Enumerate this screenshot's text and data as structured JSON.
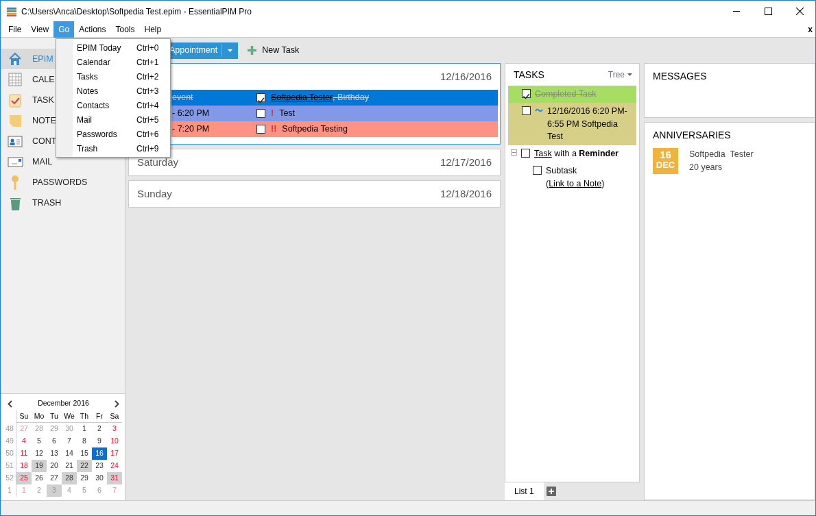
{
  "window": {
    "title": "C:\\Users\\Anca\\Desktop\\Softpedia Test.epim - EssentialPIM Pro"
  },
  "menu_bar": [
    {
      "label": "File",
      "selected": false
    },
    {
      "label": "View",
      "selected": false
    },
    {
      "label": "Go",
      "selected": true
    },
    {
      "label": "Actions",
      "selected": false
    },
    {
      "label": "Tools",
      "selected": false
    },
    {
      "label": "Help",
      "selected": false
    }
  ],
  "menu_close": "x",
  "go_menu": [
    {
      "label": "EPIM Today",
      "shortcut": "Ctrl+0"
    },
    {
      "label": "Calendar",
      "shortcut": "Ctrl+1"
    },
    {
      "label": "Tasks",
      "shortcut": "Ctrl+2"
    },
    {
      "label": "Notes",
      "shortcut": "Ctrl+3"
    },
    {
      "label": "Contacts",
      "shortcut": "Ctrl+4"
    },
    {
      "label": "Mail",
      "shortcut": "Ctrl+5"
    },
    {
      "label": "Passwords",
      "shortcut": "Ctrl+6"
    },
    {
      "label": "Trash",
      "shortcut": "Ctrl+9"
    }
  ],
  "toolbar": {
    "appointment_button": "Appointment",
    "new_task_button": "New Task"
  },
  "sidebar": {
    "items": [
      {
        "label": "EPIM",
        "kind": "home",
        "selected": true
      },
      {
        "label": "CALE",
        "kind": "calendar",
        "selected": false
      },
      {
        "label": "TASK",
        "kind": "tasks",
        "selected": false
      },
      {
        "label": "NOTE",
        "kind": "notes",
        "selected": false
      },
      {
        "label": "CONT",
        "kind": "contacts",
        "selected": false
      },
      {
        "label": "MAIL",
        "kind": "mail",
        "selected": false
      },
      {
        "label": "PASSWORDS",
        "kind": "passwords",
        "selected": false
      },
      {
        "label": "TRASH",
        "kind": "trash",
        "selected": false
      }
    ]
  },
  "mini_calendar": {
    "month": "December  2016",
    "weekdays": [
      "Su",
      "Mo",
      "Tu",
      "We",
      "Th",
      "Fr",
      "Sa"
    ],
    "weeks": [
      {
        "number": "48",
        "days": [
          {
            "text": "27",
            "other_month": true,
            "marked": false,
            "selected": false
          },
          {
            "text": "28",
            "other_month": true,
            "marked": false,
            "selected": false
          },
          {
            "text": "29",
            "other_month": true,
            "marked": false,
            "selected": false
          },
          {
            "text": "30",
            "other_month": true,
            "marked": false,
            "selected": false
          },
          {
            "text": "1",
            "other_month": false,
            "marked": false,
            "selected": false
          },
          {
            "text": "2",
            "other_month": false,
            "marked": false,
            "selected": false
          },
          {
            "text": "3",
            "other_month": false,
            "marked": false,
            "selected": false
          }
        ]
      },
      {
        "number": "49",
        "days": [
          {
            "text": "4",
            "other_month": false,
            "marked": false,
            "selected": false
          },
          {
            "text": "5",
            "other_month": false,
            "marked": false,
            "selected": false
          },
          {
            "text": "6",
            "other_month": false,
            "marked": false,
            "selected": false
          },
          {
            "text": "7",
            "other_month": false,
            "marked": false,
            "selected": false
          },
          {
            "text": "8",
            "other_month": false,
            "marked": false,
            "selected": false
          },
          {
            "text": "9",
            "other_month": false,
            "marked": false,
            "selected": false
          },
          {
            "text": "10",
            "other_month": false,
            "marked": false,
            "selected": false
          }
        ]
      },
      {
        "number": "50",
        "days": [
          {
            "text": "11",
            "other_month": false,
            "marked": false,
            "selected": false
          },
          {
            "text": "12",
            "other_month": false,
            "marked": false,
            "selected": false
          },
          {
            "text": "13",
            "other_month": false,
            "marked": false,
            "selected": false
          },
          {
            "text": "14",
            "other_month": false,
            "marked": false,
            "selected": false
          },
          {
            "text": "15",
            "other_month": false,
            "marked": false,
            "selected": false
          },
          {
            "text": "16",
            "other_month": false,
            "marked": false,
            "selected": true
          },
          {
            "text": "17",
            "other_month": false,
            "marked": false,
            "selected": false
          }
        ]
      },
      {
        "number": "51",
        "days": [
          {
            "text": "18",
            "other_month": false,
            "marked": false,
            "selected": false
          },
          {
            "text": "19",
            "other_month": false,
            "marked": true,
            "selected": false
          },
          {
            "text": "20",
            "other_month": false,
            "marked": false,
            "selected": false
          },
          {
            "text": "21",
            "other_month": false,
            "marked": false,
            "selected": false
          },
          {
            "text": "22",
            "other_month": false,
            "marked": true,
            "selected": false
          },
          {
            "text": "23",
            "other_month": false,
            "marked": false,
            "selected": false
          },
          {
            "text": "24",
            "other_month": false,
            "marked": false,
            "selected": false
          }
        ]
      },
      {
        "number": "52",
        "days": [
          {
            "text": "25",
            "other_month": false,
            "marked": true,
            "selected": false
          },
          {
            "text": "26",
            "other_month": false,
            "marked": false,
            "selected": false
          },
          {
            "text": "27",
            "other_month": false,
            "marked": false,
            "selected": false
          },
          {
            "text": "28",
            "other_month": false,
            "marked": true,
            "selected": false
          },
          {
            "text": "29",
            "other_month": false,
            "marked": false,
            "selected": false
          },
          {
            "text": "30",
            "other_month": false,
            "marked": false,
            "selected": false
          },
          {
            "text": "31",
            "other_month": false,
            "marked": true,
            "selected": false
          }
        ]
      },
      {
        "number": "1",
        "days": [
          {
            "text": "1",
            "other_month": true,
            "marked": false,
            "selected": false
          },
          {
            "text": "2",
            "other_month": true,
            "marked": false,
            "selected": false
          },
          {
            "text": "3",
            "other_month": true,
            "marked": true,
            "selected": false
          },
          {
            "text": "4",
            "other_month": true,
            "marked": false,
            "selected": false
          },
          {
            "text": "5",
            "other_month": true,
            "marked": false,
            "selected": false
          },
          {
            "text": "6",
            "other_month": true,
            "marked": false,
            "selected": false
          },
          {
            "text": "7",
            "other_month": true,
            "marked": false,
            "selected": false
          }
        ]
      }
    ]
  },
  "days": [
    {
      "date": "12/16/2016",
      "selected": true,
      "events": [
        {
          "lead": "event",
          "checked": true,
          "link": "Softpedia  Tester",
          "title": ", Birthday",
          "color": "#0078d7"
        },
        {
          "lead": "- 6:20 PM",
          "checked": false,
          "priority": "!",
          "title": "Test",
          "color": "#8199e6"
        },
        {
          "lead": "- 7:20 PM",
          "checked": false,
          "priority": "!!",
          "title": "Softpedia Testing",
          "color": "#ff9282"
        }
      ]
    },
    {
      "name": "Saturday",
      "date": "12/17/2016",
      "selected": false
    },
    {
      "name": "Sunday",
      "date": "12/18/2016",
      "selected": false
    }
  ],
  "tasks": {
    "title": "TASKS",
    "view": "Tree",
    "items": [
      {
        "checked": true,
        "parts": [
          {
            "text": "Completed Task"
          }
        ],
        "color": "#a8dd64"
      },
      {
        "checked": false,
        "recurring": true,
        "parts": [
          {
            "text": "12/16/2016 6:20 PM-6:55 PM Softpedia Test"
          }
        ],
        "color": "#d6cf88"
      },
      {
        "checked": false,
        "expanded": true,
        "parts": [
          {
            "text": "Task",
            "link": true
          },
          {
            "text": " with a **Reminder**"
          }
        ],
        "children": [
          {
            "checked": false,
            "parts": [
              {
                "text": "Subtask ("
              },
              {
                "text": "Link to a Note",
                "link": true
              },
              {
                "text": ")"
              }
            ]
          }
        ]
      }
    ],
    "tabs": [
      {
        "label": "List 1",
        "selected": true
      }
    ]
  },
  "messages": {
    "title": "MESSAGES"
  },
  "anniversaries": {
    "title": "ANNIVERSARIES",
    "items": [
      {
        "day": "16",
        "month": "DEC",
        "name": "Softpedia  Tester",
        "years": "20 years"
      }
    ]
  }
}
